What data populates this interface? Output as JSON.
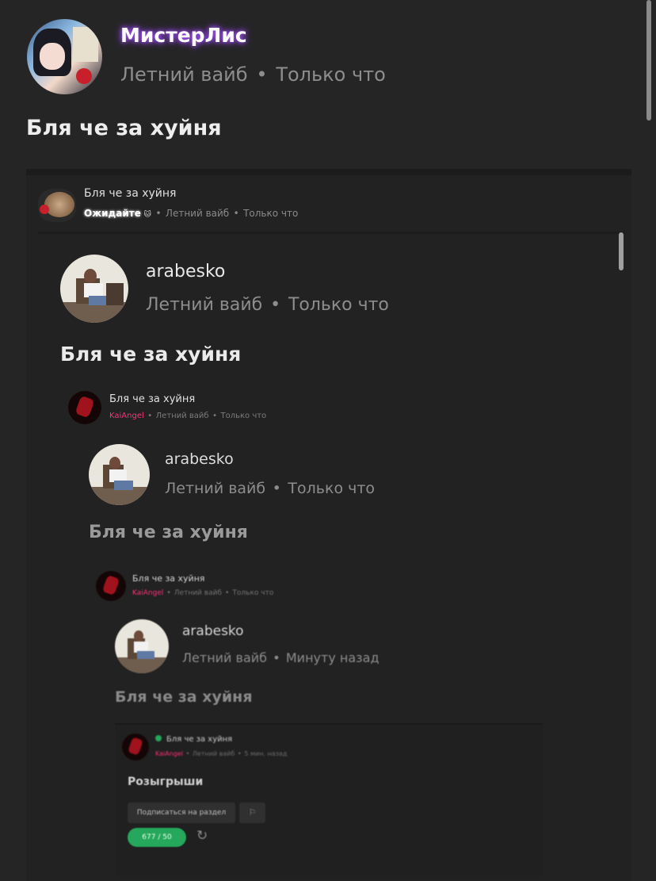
{
  "level0": {
    "author": "МистерЛис",
    "category": "Летний вайб",
    "time": "Только что",
    "text": "Бля че за хуйня"
  },
  "quote1": {
    "title": "Бля че за хуйня",
    "author": "Ожидайте",
    "category": "Летний вайб",
    "time": "Только что"
  },
  "level1": {
    "author": "arabesko",
    "category": "Летний вайб",
    "time": "Только что",
    "text": "Бля че за хуйня"
  },
  "quote2": {
    "title": "Бля че за хуйня",
    "author": "KaiAngel",
    "category": "Летний вайб",
    "time": "Только что"
  },
  "level2": {
    "author": "arabesko",
    "category": "Летний вайб",
    "time": "Только что",
    "text": "Бля че за хуйня"
  },
  "quote3": {
    "title": "Бля че за хуйня",
    "author": "KaiAngel",
    "category": "Летний вайб",
    "time": "Только что"
  },
  "level3": {
    "author": "arabesko",
    "category": "Летний вайб",
    "time": "Минуту назад",
    "text": "Бля че за хуйня"
  },
  "quote4": {
    "title": "Бля че за хуйня",
    "author": "KaiAngel",
    "category": "Летний вайб",
    "time": "5 мин. назад",
    "section": "Розыгрыши",
    "subscribe_label": "Подписаться на раздел",
    "counter": "677 / 50"
  },
  "colors": {
    "accent_purple": "#a24bff",
    "kaiangel_pink": "#ff2f7a",
    "green": "#25a85c"
  }
}
